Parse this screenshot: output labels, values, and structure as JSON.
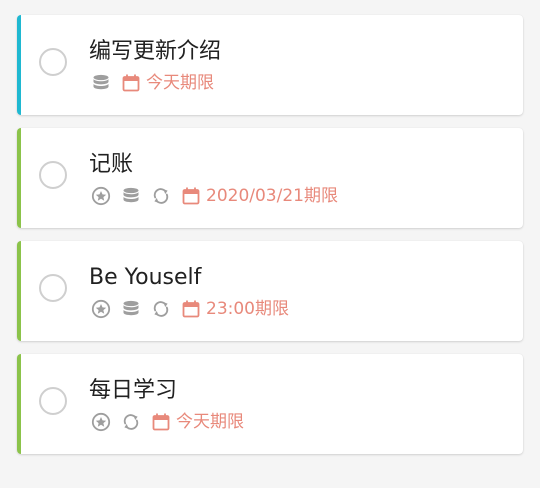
{
  "colors": {
    "accent_cyan": "#1fb8d1",
    "accent_green": "#8bc34a",
    "due_text": "#e8897b",
    "icon_gray": "#9e9e9e",
    "checkbox_border": "#cfcfcf"
  },
  "tasks": [
    {
      "title": "编写更新介绍",
      "accent": "cyan",
      "icons": [
        "database-icon"
      ],
      "due": "今天期限"
    },
    {
      "title": "记账",
      "accent": "green",
      "icons": [
        "star-circle-icon",
        "database-icon",
        "repeat-icon"
      ],
      "due": "2020/03/21期限"
    },
    {
      "title": "Be Youself",
      "accent": "green",
      "icons": [
        "star-circle-icon",
        "database-icon",
        "repeat-icon"
      ],
      "due": "23:00期限"
    },
    {
      "title": "每日学习",
      "accent": "green",
      "icons": [
        "star-circle-icon",
        "repeat-icon"
      ],
      "due": "今天期限"
    }
  ]
}
